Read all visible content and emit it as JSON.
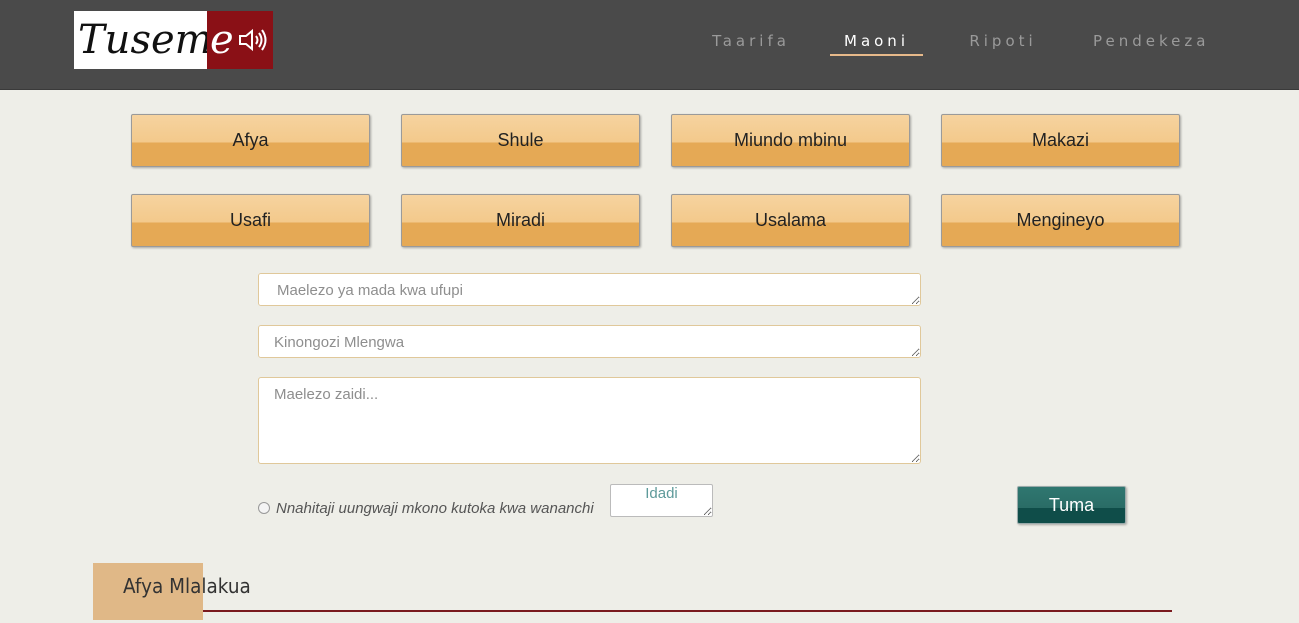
{
  "header": {
    "logo_text": "Tuseme",
    "nav": [
      {
        "label": "Taarifa",
        "active": false
      },
      {
        "label": "Maoni",
        "active": true
      },
      {
        "label": "Ripoti",
        "active": false
      },
      {
        "label": "Pendekeza",
        "active": false
      }
    ]
  },
  "categories": [
    {
      "label": "Afya"
    },
    {
      "label": "Shule"
    },
    {
      "label": "Miundo mbinu"
    },
    {
      "label": "Makazi"
    },
    {
      "label": "Usafi"
    },
    {
      "label": "Miradi"
    },
    {
      "label": "Usalama"
    },
    {
      "label": "Mengineyo"
    }
  ],
  "form": {
    "summary_placeholder": "Maelezo ya mada kwa ufupi",
    "leader_placeholder": "Kinongozi Mlengwa",
    "details_placeholder": "Maelezo zaidi...",
    "support_label": "Nnahitaji uungwaji mkono kutoka kwa wananchi",
    "count_placeholder": "Idadi",
    "submit_label": "Tuma"
  },
  "section": {
    "title": "Afya Mlalakua"
  },
  "colors": {
    "header_bg": "#4a4a4a",
    "accent_orange": "#e5a955",
    "submit_teal": "#2a6c66",
    "rule_maroon": "#7a1a1f",
    "logo_red": "#8a1016"
  }
}
